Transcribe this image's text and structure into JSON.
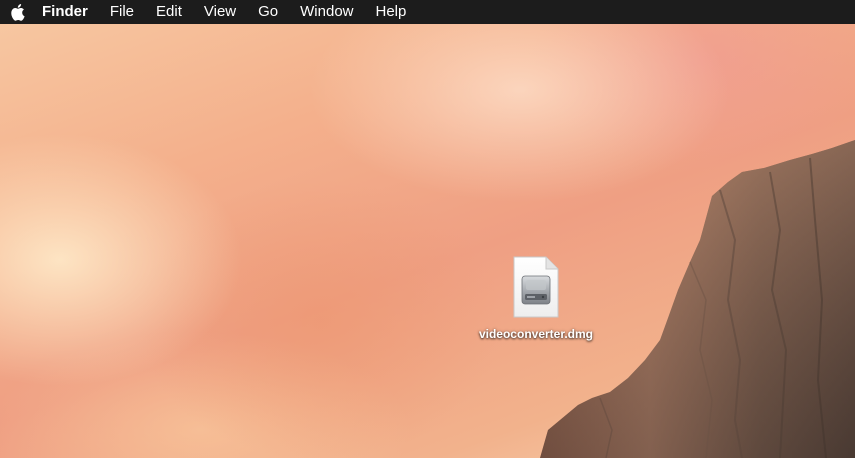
{
  "menubar": {
    "apple_icon": "apple-logo-icon",
    "app_name": "Finder",
    "items": [
      {
        "label": "File"
      },
      {
        "label": "Edit"
      },
      {
        "label": "View"
      },
      {
        "label": "Go"
      },
      {
        "label": "Window"
      },
      {
        "label": "Help"
      }
    ]
  },
  "desktop": {
    "wallpaper": "yosemite-el-capitan-sunset",
    "icons": [
      {
        "label": "videoconverter.dmg",
        "icon": "disk-image-file-icon"
      }
    ]
  },
  "colors": {
    "menubar_bg": "#1c1c1c",
    "menubar_text": "#ffffff",
    "sky_top": "#f7c9a3",
    "sky_mid": "#ef9f83",
    "rock": "#7a6253"
  }
}
